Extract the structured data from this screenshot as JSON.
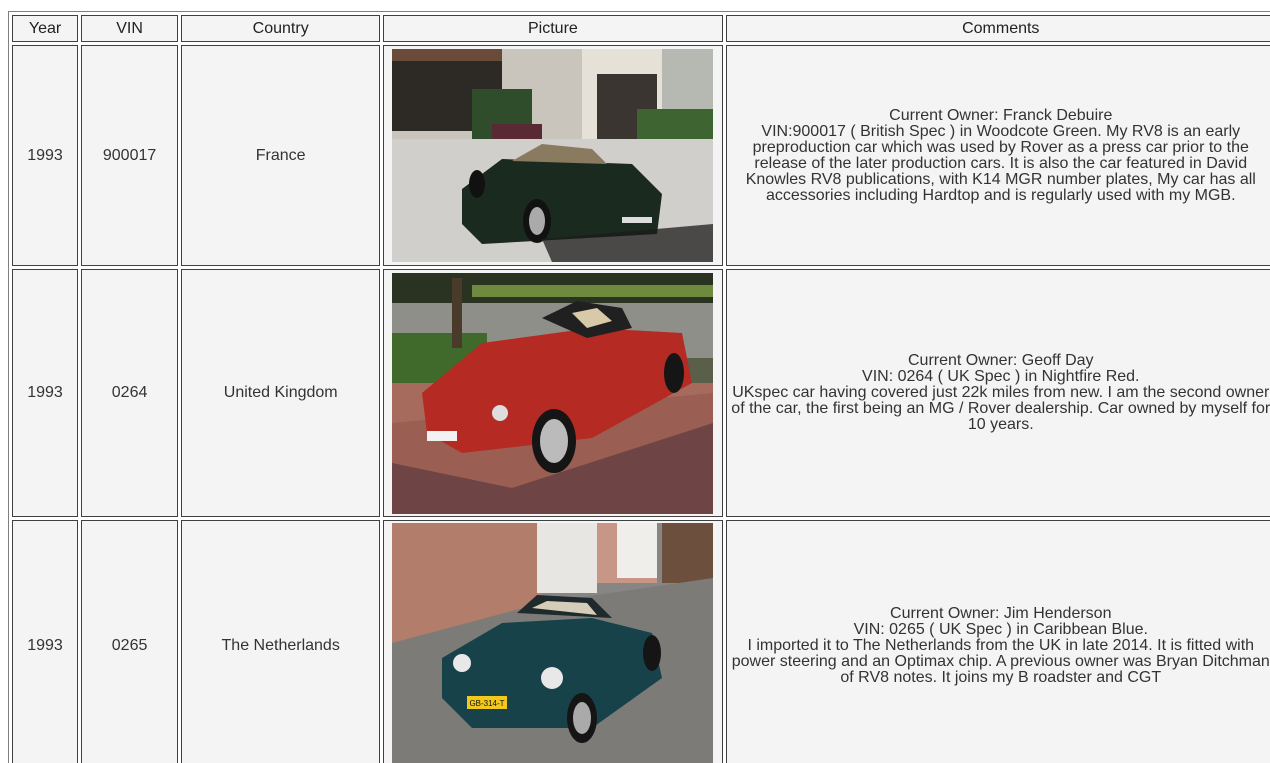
{
  "headers": {
    "year": "Year",
    "vin": "VIN",
    "country": "Country",
    "picture": "Picture",
    "comments": "Comments"
  },
  "rows": [
    {
      "year": "1993",
      "vin": "900017",
      "country": "France",
      "picture": "black-rv8-photo",
      "comments": [
        "Current Owner: Franck Debuire",
        "VIN:900017 ( British Spec ) in Woodcote Green. My RV8 is an early preproduction car which was used by Rover as a press car prior to the release of the later production cars. It is also the car featured in David Knowles RV8 publications, with K14 MGR number plates, My car has all accessories including Hardtop and is regularly used with my MGB."
      ]
    },
    {
      "year": "1993",
      "vin": "0264",
      "country": "United Kingdom",
      "picture": "red-rv8-photo",
      "comments": [
        "Current Owner: Geoff Day",
        "VIN: 0264 ( UK Spec ) in Nightfire Red.",
        "UKspec car having covered just 22k miles from new. I am the second owner of the car, the first being an MG / Rover dealership. Car owned by myself for 10 years."
      ]
    },
    {
      "year": "1993",
      "vin": "0265",
      "country": "The Netherlands",
      "picture": "blue-rv8-photo",
      "comments": [
        "Current Owner: Jim Henderson",
        "VIN: 0265 ( UK Spec ) in Caribbean Blue.",
        "I imported it to The Netherlands from the UK in late 2014. It is fitted with power steering and an Optimax chip. A previous owner was Bryan Ditchman of RV8 notes. It joins my B roadster and CGT"
      ],
      "plate": "GB-314-T"
    }
  ]
}
